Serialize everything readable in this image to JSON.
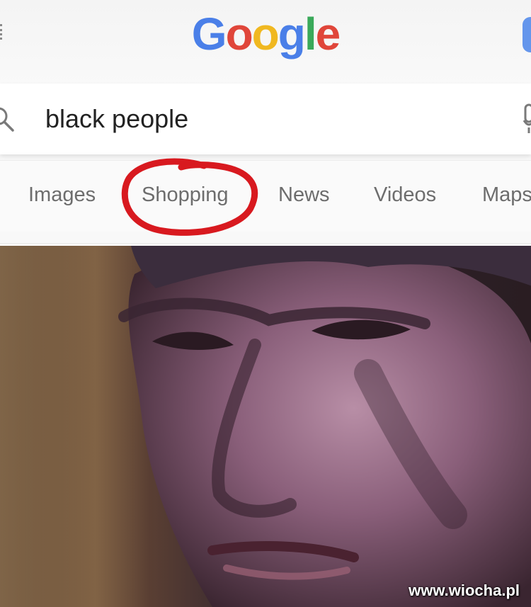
{
  "logo": {
    "letters": [
      "G",
      "o",
      "o",
      "g",
      "l",
      "e"
    ]
  },
  "search": {
    "query": "black people"
  },
  "tabs": [
    {
      "label": "Images"
    },
    {
      "label": "Shopping",
      "highlighted": true
    },
    {
      "label": "News"
    },
    {
      "label": "Videos"
    },
    {
      "label": "Maps"
    }
  ],
  "annotation": {
    "shape": "hand-drawn circle",
    "color": "#d8191f",
    "target": "Shopping"
  },
  "icons": {
    "search": "search-icon",
    "mic": "mic-icon"
  },
  "watermark": {
    "text": "www.wiocha.pl"
  },
  "colors": {
    "google_blue": "#4a7fe8",
    "google_red": "#e0463a",
    "google_yellow": "#f0b820",
    "google_green": "#3aa95a",
    "circle_red": "#d8191f"
  }
}
